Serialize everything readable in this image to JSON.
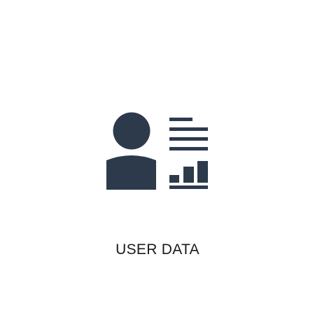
{
  "icon": {
    "name": "user-data-icon",
    "color": "#2c3a4c"
  },
  "caption": "USER DATA"
}
